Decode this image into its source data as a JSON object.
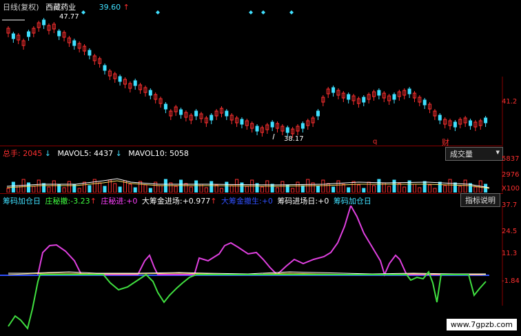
{
  "header": {
    "period_label": "日线(复权)",
    "stock_name": "西藏药业",
    "price_value": "39.60",
    "up_arrow": "↑"
  },
  "price_pane": {
    "high_label": "47.77",
    "low_label": "38.17",
    "right_tick": "41.2",
    "markers": [
      "q",
      "财"
    ],
    "colors": {
      "up": "#ff3030",
      "down": "#40e0ff",
      "bg": "#000000"
    }
  },
  "volume_pane": {
    "total_label": "总手:",
    "total_value": "2045",
    "mavol5_label": "MAVOL5:",
    "mavol5_value": "4437",
    "mavol10_label": "MAVOL10:",
    "mavol10_value": "5058",
    "arrow_down": "↓",
    "button_label": "成交量",
    "dropdown_icon": "chevron-down-icon",
    "ticks": [
      "5837",
      "2976",
      "X100"
    ]
  },
  "indicator_pane": {
    "name": "筹码加仓日",
    "series": [
      {
        "label": "庄秘撤:",
        "value": "-3.23",
        "arrow": "↑",
        "color": "#40ff40"
      },
      {
        "label": "庄秘进:",
        "value": "+0",
        "arrow": "",
        "color": "#ff40ff"
      },
      {
        "label": "大筹金进场:",
        "value": "+0.977",
        "arrow": "↑",
        "color": "#ffffff"
      },
      {
        "label": "大筹金撤生:",
        "value": "+0",
        "arrow": "",
        "color": "#3050ff"
      },
      {
        "label": "筹码进场日:",
        "value": "+0",
        "arrow": "",
        "color": "#ffffff"
      },
      {
        "label": "筹码加仓日",
        "value": "",
        "arrow": "",
        "color": "#40e0ff"
      }
    ],
    "button_label": "指标说明",
    "ticks": [
      "37.7",
      "24.5",
      "11.3",
      "-1.84"
    ]
  },
  "watermark": "www.7gpzb.com"
}
